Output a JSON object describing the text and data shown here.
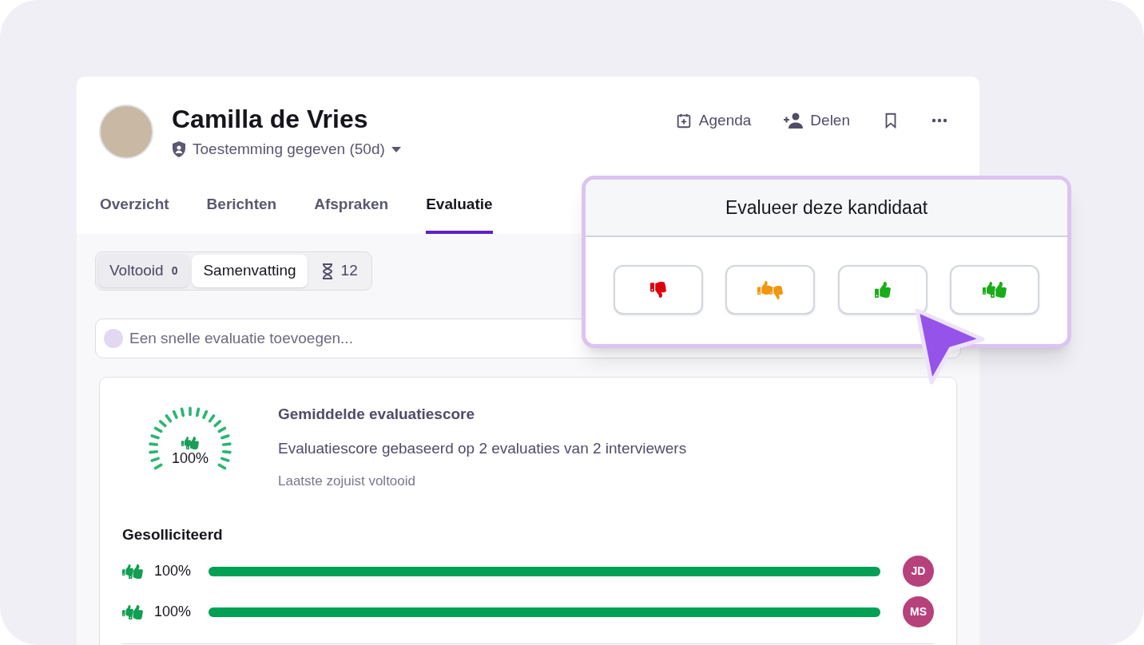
{
  "candidate": {
    "name": "Camilla de Vries",
    "consent": "Toestemming gegeven (50d)"
  },
  "actions": [
    {
      "kind": "calendar",
      "label": "Agenda"
    },
    {
      "kind": "share",
      "label": "Delen"
    },
    {
      "kind": "bookmark"
    },
    {
      "kind": "more"
    }
  ],
  "tabs": [
    {
      "label": "Overzicht",
      "selected": false
    },
    {
      "label": "Berichten",
      "selected": false
    },
    {
      "label": "Afspraken",
      "selected": false
    },
    {
      "label": "Evaluatie",
      "selected": true
    }
  ],
  "segments": [
    {
      "kind": "count",
      "label": "Voltooid",
      "count": "0",
      "selected": false
    },
    {
      "kind": "text",
      "label": "Samenvatting",
      "selected": true
    },
    {
      "kind": "pending",
      "count": "12",
      "selected": false
    }
  ],
  "quick_evaluation": {
    "placeholder": "Een snelle evaluatie toevoegen..."
  },
  "rating_popup": {
    "title": "Evalueer deze kandidaat",
    "options": [
      {
        "kind": "strong_no",
        "color": "#e0000b"
      },
      {
        "kind": "mixed",
        "color": "#f0960f"
      },
      {
        "kind": "yes",
        "color": "#1aad1a"
      },
      {
        "kind": "strong_yes",
        "color": "#1aad1a"
      }
    ]
  },
  "score": {
    "level": 1,
    "reading": "100%",
    "title": "Gemiddelde evaluatiescore",
    "description": "Evaluatiescore gebaseerd op 2 evaluaties van 2 interviewers",
    "meta": "Laatste zojuist voltooid"
  },
  "stage": {
    "title": "Gesolliciteerd",
    "rows": [
      {
        "reading": "100%",
        "level": 1,
        "initials": "JD"
      },
      {
        "reading": "100%",
        "level": 1,
        "initials": "MS"
      }
    ]
  }
}
